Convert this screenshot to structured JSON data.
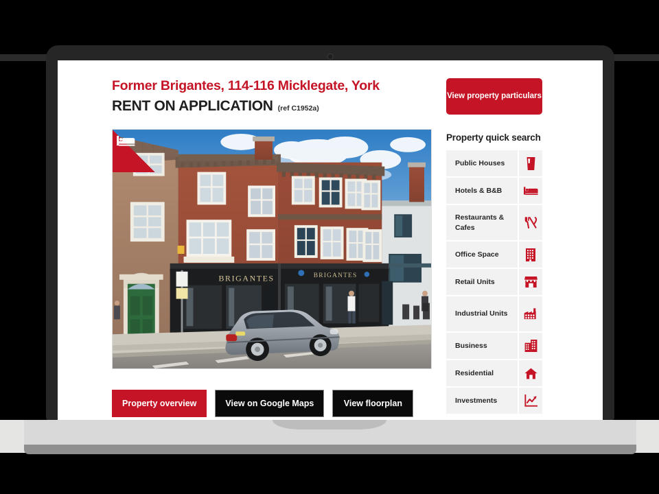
{
  "device": {
    "type": "laptop-mockup",
    "camera_icon": "camera-dot-icon"
  },
  "property": {
    "title": "Former Brigantes, 114-116 Micklegate, York",
    "price": "RENT ON APPLICATION",
    "reference": "(ref C1952a)",
    "photo_alt": "Brigantes shopfront, Georgian brick terrace on Micklegate with parked grey saloon car",
    "ribbon_icon": "bed-icon",
    "shopfront_signs": [
      "BRIGANTES",
      "BRIGANTES"
    ]
  },
  "cta_buttons": [
    {
      "label": "Property overview",
      "style": "red",
      "name": "property-overview-button"
    },
    {
      "label": "View on Google Maps",
      "style": "dark",
      "name": "view-on-google-maps-button"
    },
    {
      "label": "View floorplan",
      "style": "dark",
      "name": "view-floorplan-button"
    }
  ],
  "sidebar": {
    "particulars_label": "View property particulars",
    "quick_search_heading": "Property quick search",
    "quick_search_items": [
      {
        "label": "Public Houses",
        "icon": "pint-glass-icon",
        "tall": false
      },
      {
        "label": "Hotels & B&B",
        "icon": "bed-icon",
        "tall": false
      },
      {
        "label": "Restaurants & Cafes",
        "icon": "cutlery-icon",
        "tall": true
      },
      {
        "label": "Office Space",
        "icon": "office-block-icon",
        "tall": false
      },
      {
        "label": "Retail Units",
        "icon": "shop-awning-icon",
        "tall": false
      },
      {
        "label": "Industrial Units",
        "icon": "factory-icon",
        "tall": true
      },
      {
        "label": "Business",
        "icon": "buildings-icon",
        "tall": false
      },
      {
        "label": "Residential",
        "icon": "house-icon",
        "tall": false
      },
      {
        "label": "Investments",
        "icon": "line-chart-icon",
        "tall": false
      }
    ]
  },
  "colors": {
    "brand_red": "#c41425",
    "text_dark": "#1f1f1f",
    "row_grey": "#f2f2f2",
    "bezel": "#262626",
    "base_light": "#d9d9d9",
    "base_shadow": "#8f8f8f",
    "backdrop_band": "#e5e5e3"
  }
}
